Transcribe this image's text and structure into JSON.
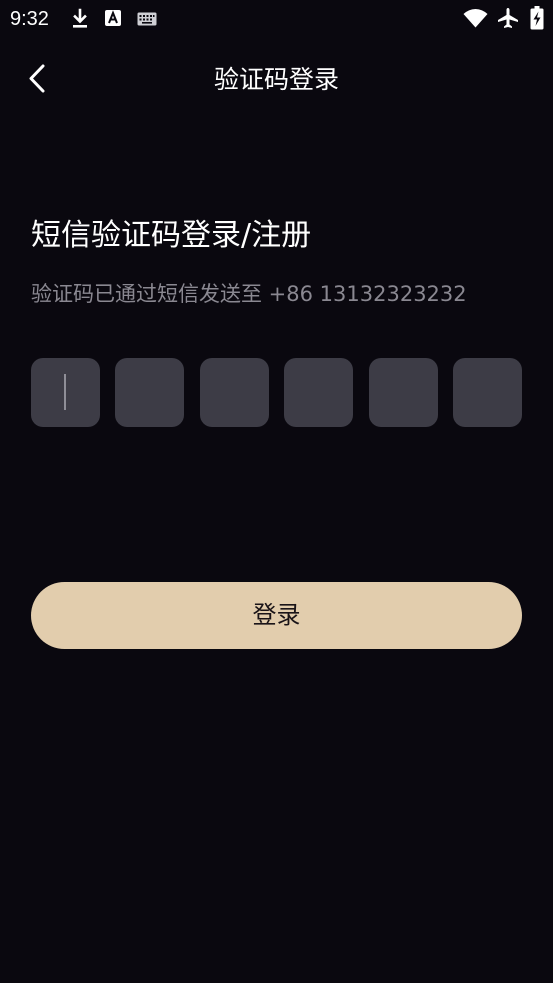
{
  "status_bar": {
    "time": "9:32",
    "icons": [
      "download-icon",
      "font-a-icon",
      "keyboard-icon",
      "wifi-icon",
      "airplane-icon",
      "battery-charging-icon"
    ]
  },
  "header": {
    "back_icon": "chevron-left-icon",
    "title": "验证码登录"
  },
  "main": {
    "heading": "短信验证码登录/注册",
    "subtext": "验证码已通过短信发送至 +86 13132323232",
    "code_length": 6,
    "code_digits": [
      "",
      "",
      "",
      "",
      "",
      ""
    ]
  },
  "login_button": {
    "label": "登录"
  },
  "colors": {
    "background": "#0a080f",
    "box": "#3d3c46",
    "accent": "#e2cdad",
    "muted_text": "#8a8891"
  }
}
